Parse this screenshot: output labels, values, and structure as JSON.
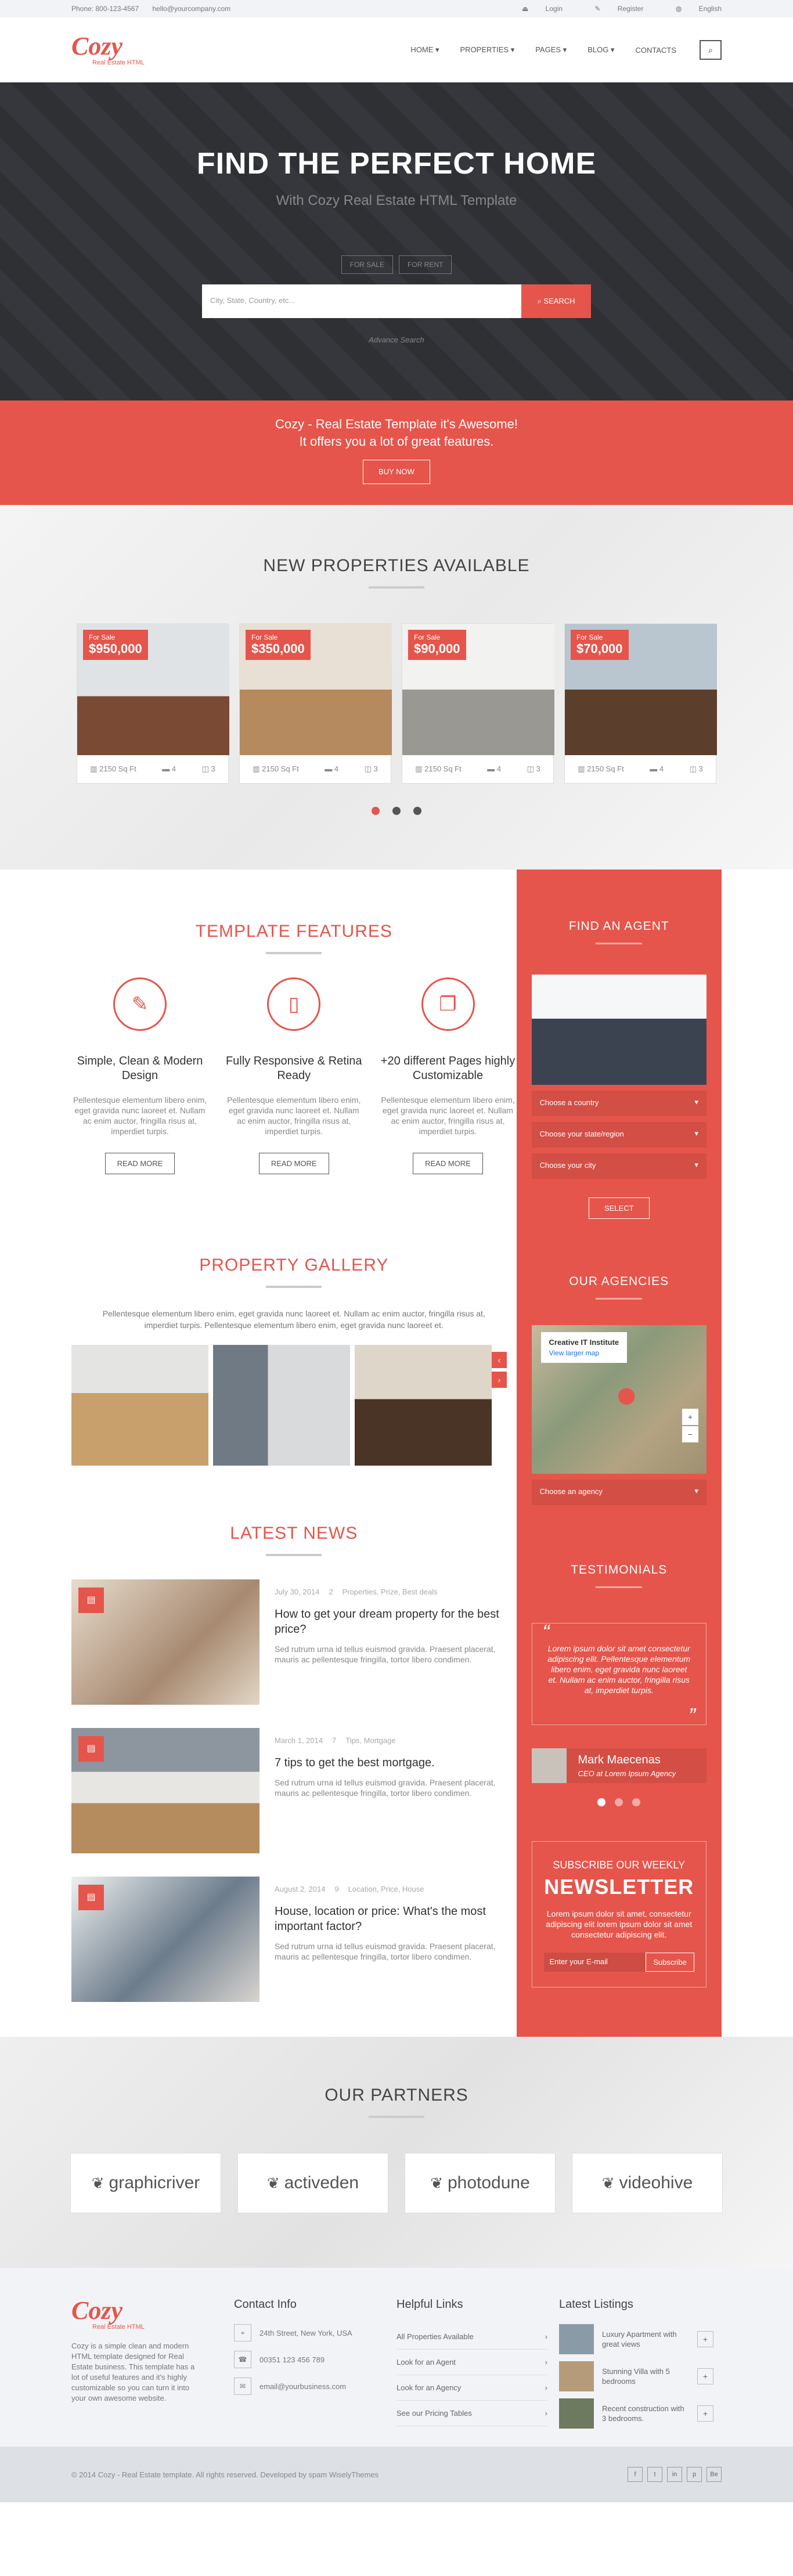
{
  "topbar": {
    "phone": "Phone: 800-123-4567",
    "email": "hello@yourcompany.com",
    "login": "Login",
    "register": "Register",
    "language": "English"
  },
  "header": {
    "logo_word": "Cozy",
    "logo_sub": "Real Estate HTML",
    "nav": [
      "HOME ▾",
      "PROPERTIES ▾",
      "PAGES ▾",
      "BLOG ▾",
      "CONTACTS"
    ]
  },
  "hero": {
    "title": "FIND THE PERFECT HOME",
    "subtitle": "With Cozy Real Estate HTML Template",
    "tab_sale": "FOR SALE",
    "tab_rent": "FOR RENT",
    "search_placeholder": "City, State, Country, etc...",
    "search_button": "SEARCH",
    "advanced": "Advance Search"
  },
  "promo": {
    "line1": "Cozy - Real Estate Template it's Awesome!",
    "line2": "It offers you a lot of great features.",
    "button": "BUY NOW"
  },
  "new_properties": {
    "title": "NEW PROPERTIES AVAILABLE",
    "items": [
      {
        "status": "For Sale",
        "price": "$950,000",
        "area": "2150 Sq Ft",
        "beds": "4",
        "baths": "3"
      },
      {
        "status": "For Sale",
        "price": "$350,000",
        "area": "2150 Sq Ft",
        "beds": "4",
        "baths": "3"
      },
      {
        "status": "For Sale",
        "price": "$90,000",
        "area": "2150 Sq Ft",
        "beds": "4",
        "baths": "3"
      },
      {
        "status": "For Sale",
        "price": "$70,000",
        "area": "2150 Sq Ft",
        "beds": "4",
        "baths": "3"
      }
    ]
  },
  "features": {
    "title": "TEMPLATE FEATURES",
    "items": [
      {
        "icon": "pencil-icon",
        "title": "Simple, Clean & Modern Design",
        "text": "Pellentesque elementum libero enim, eget gravida nunc laoreet et. Nullam ac enim auctor, fringilla risus at, imperdiet turpis.",
        "button": "READ MORE"
      },
      {
        "icon": "tablet-icon",
        "title": "Fully Responsive & Retina Ready",
        "text": "Pellentesque elementum libero enim, eget gravida nunc laoreet et. Nullam ac enim auctor, fringilla risus at, imperdiet turpis.",
        "button": "READ MORE"
      },
      {
        "icon": "copy-icon",
        "title": "+20 different Pages highly Customizable",
        "text": "Pellentesque elementum libero enim, eget gravida nunc laoreet et. Nullam ac enim auctor, fringilla risus at, imperdiet turpis.",
        "button": "READ MORE"
      }
    ]
  },
  "gallery": {
    "title": "PROPERTY GALLERY",
    "text": "Pellentesque elementum libero enim, eget gravida nunc laoreet et. Nullam ac enim auctor, fringilla risus at, imperdiet turpis. Pellentesque elementum libero enim, eget gravida nunc laoreet et."
  },
  "news": {
    "title": "LATEST NEWS",
    "items": [
      {
        "date": "July 30, 2014",
        "comments": "2",
        "tags": "Properties, Prize, Best deals",
        "title": "How to get your dream property for the best price?",
        "text": "Sed rutrum urna id tellus euismod gravida. Praesent placerat, mauris ac pellentesque fringilla, tortor libero condimen."
      },
      {
        "date": "March 1, 2014",
        "comments": "7",
        "tags": "Tips, Mortgage",
        "title": "7 tips to get the best mortgage.",
        "text": "Sed rutrum urna id tellus euismod gravida. Praesent placerat, mauris ac pellentesque fringilla, tortor libero condimen."
      },
      {
        "date": "August 2, 2014",
        "comments": "9",
        "tags": "Location, Price, House",
        "title": "House, location or price: What's the most important factor?",
        "text": "Sed rutrum urna id tellus euismod gravida. Praesent placerat, mauris ac pellentesque fringilla, tortor libero condimen."
      }
    ]
  },
  "sidebar": {
    "agent_title": "FIND AN AGENT",
    "country": "Choose a country",
    "state": "Choose your state/region",
    "city": "Choose your city",
    "select_button": "SELECT",
    "agencies_title": "OUR AGENCIES",
    "map_card_title": "Creative IT Institute",
    "map_card_link": "View larger map",
    "agency_select": "Choose an agency",
    "testimonials_title": "TESTIMONIALS",
    "testimonial_text": "Lorem ipsum dolor sit amet consectetur adipiscing elit. Pellentesque elementum libero enim, eget gravida nunc laoreet et. Nullam ac enim auctor, fringilla risus at, imperdiet turpis.",
    "author_name": "Mark Maecenas",
    "author_role": "CEO at Lorem Ipsum Agency",
    "newsletter_line1": "SUBSCRIBE OUR WEEKLY",
    "newsletter_line2": "NEWSLETTER",
    "newsletter_text": "Lorem ipsum dolor sit amet, consectetur adipiscing elit lorem ipsum dolor sit amet consectetur adipiscing elit.",
    "newsletter_placeholder": "Enter your E-mail",
    "newsletter_button": "Subscribe"
  },
  "partners": {
    "title": "OUR PARTNERS",
    "items": [
      "graphicriver",
      "activeden",
      "photodune",
      "videohive"
    ]
  },
  "footer": {
    "about": "Cozy is a simple clean and modern HTML template designed for Real Estate business. This template has a lot of useful features and it's highly customizable so you can turn it into your own awesome website.",
    "contact_title": "Contact Info",
    "address": "24th Street, New York, USA",
    "phone": "00351 123 456 789",
    "email": "email@yourbusiness.com",
    "links_title": "Helpful Links",
    "links": [
      "All Properties Available",
      "Look for an Agent",
      "Look for an Agency",
      "See our Pricing Tables"
    ],
    "listings_title": "Latest Listings",
    "listings": [
      "Luxury Apartment with great views",
      "Stunning Villa with 5 bedrooms",
      "Recent construction with 3 bedrooms."
    ],
    "copyright": "© 2014 Cozy - Real Estate template. All rights reserved. Developed by spam WiselyThemes",
    "socials": [
      "f",
      "t",
      "in",
      "p",
      "Be"
    ]
  }
}
